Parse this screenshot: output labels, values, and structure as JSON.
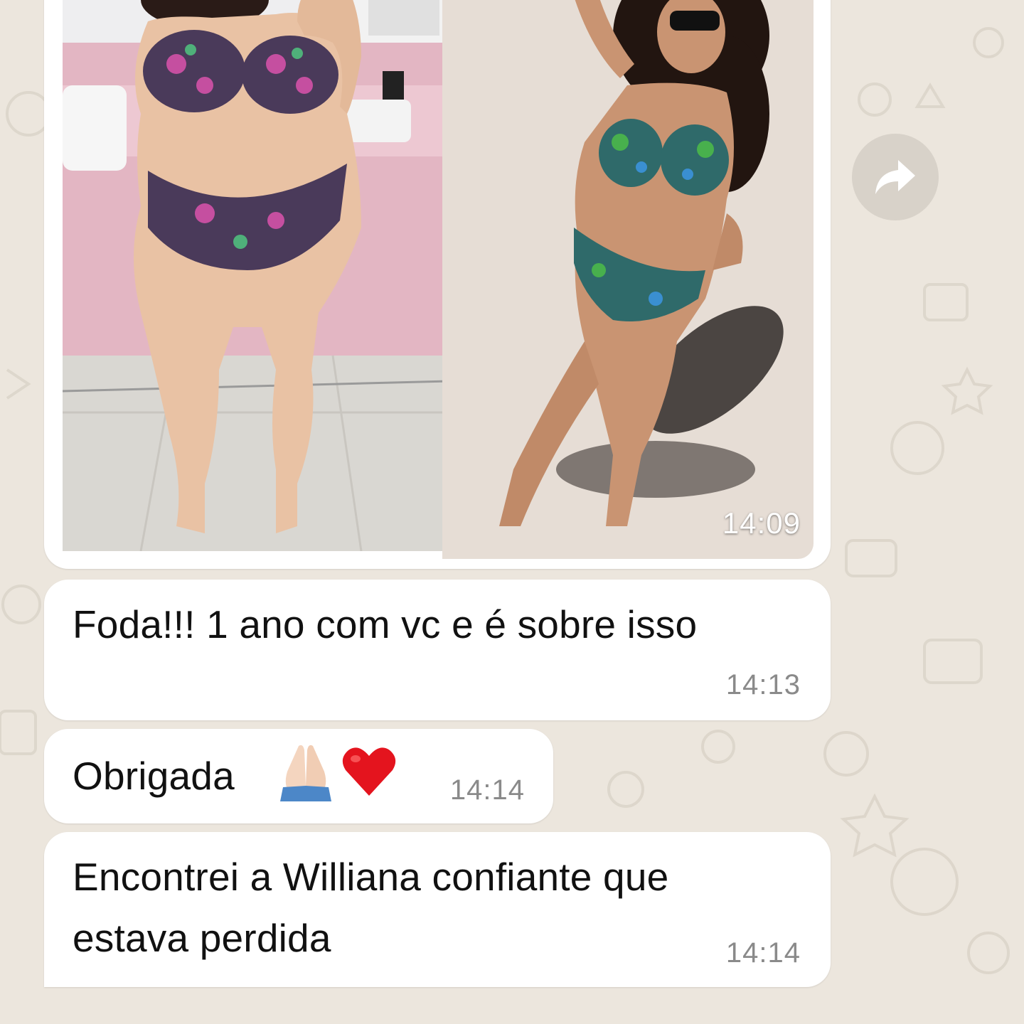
{
  "chat": {
    "image_message": {
      "time": "14:09"
    },
    "messages": [
      {
        "text": "Foda!!! 1 ano com vc e é sobre isso",
        "time": "14:13"
      },
      {
        "text": "Obrigada",
        "emojis": [
          "praying-hands",
          "red-heart"
        ],
        "time": "14:14"
      },
      {
        "text_line1": "Encontrei a Williana confiante que",
        "text_line2": "estava perdida",
        "time": "14:14"
      }
    ]
  },
  "icons": {
    "forward": "forward-arrow-icon"
  },
  "colors": {
    "background": "#ece6dd",
    "bubble": "#ffffff",
    "timestamp": "#8a8a8a",
    "forward_button": "#d8d2c9"
  }
}
